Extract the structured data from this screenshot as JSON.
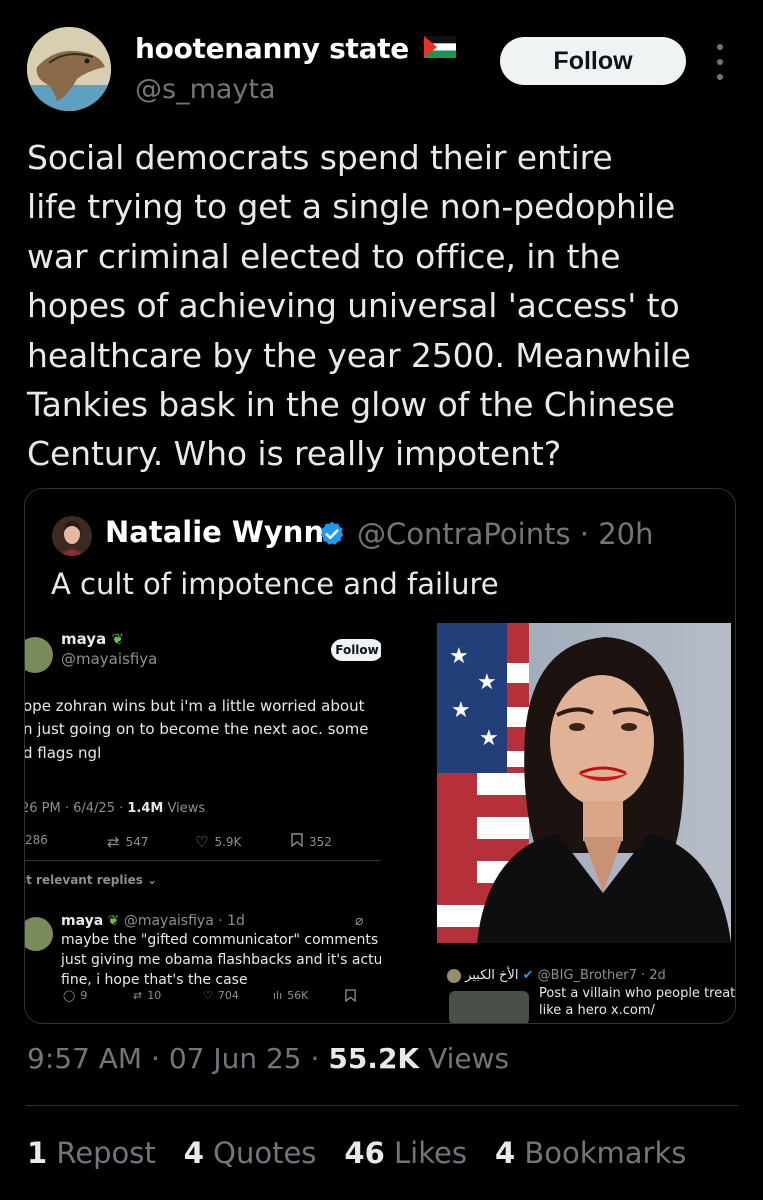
{
  "author": {
    "display_name": "hootenanny state",
    "handle": "@s_mayta",
    "follow_label": "Follow"
  },
  "tweet": {
    "text": "Social democrats spend their entire\nlife trying to get a single non-pedophile\nwar criminal elected to office, in the\nhopes of achieving universal 'access' to\nhealthcare by the year 2500. Meanwhile\nTankies bask in the glow of the Chinese\nCentury. Who is really impotent?",
    "time": "9:57 AM",
    "date": "07 Jun 25",
    "views_count": "55.2K",
    "views_label": "Views",
    "sep": "·"
  },
  "quote": {
    "name": "Natalie Wynn",
    "handle_time": "@ContraPoints · 20h",
    "text": "A cult of impotence and failure"
  },
  "embedded_post": {
    "name": "maya",
    "handle": "@mayaisfiya",
    "follow_label": "Follow",
    "lines": [
      "ope zohran wins but i'm a little worried about",
      "n just going on to become the next aoc. some",
      "d flags ngl"
    ],
    "meta_time": "26 PM · 6/4/25 ·",
    "meta_views_count": "1.4M",
    "meta_views_label": "Views",
    "stats": [
      "286",
      "547",
      "5.9K",
      "352"
    ],
    "relevant_label": "st relevant replies",
    "reply": {
      "name": "maya",
      "handle_time": "@mayaisfiya · 1d",
      "lines": [
        "maybe the \"gifted communicator\" comments a",
        "just giving me obama flashbacks and it's actual",
        "fine, i hope that's the case"
      ],
      "stats": [
        "9",
        "10",
        "704",
        "56K"
      ]
    }
  },
  "embedded_post_2": {
    "name": "الأخ الكبير",
    "handle_time": "@BIG_Brother7 · 2d",
    "text_lines": [
      "Post a villain who people treat",
      "like a hero x.com/"
    ]
  },
  "engagement": [
    {
      "count": "1",
      "label": "Repost"
    },
    {
      "count": "4",
      "label": "Quotes"
    },
    {
      "count": "46",
      "label": "Likes"
    },
    {
      "count": "4",
      "label": "Bookmarks"
    }
  ],
  "colors": {
    "background": "#000000",
    "text": "#e7e9ea",
    "muted": "#71767b",
    "verified": "#1d9bf0",
    "border": "#2f3336"
  }
}
